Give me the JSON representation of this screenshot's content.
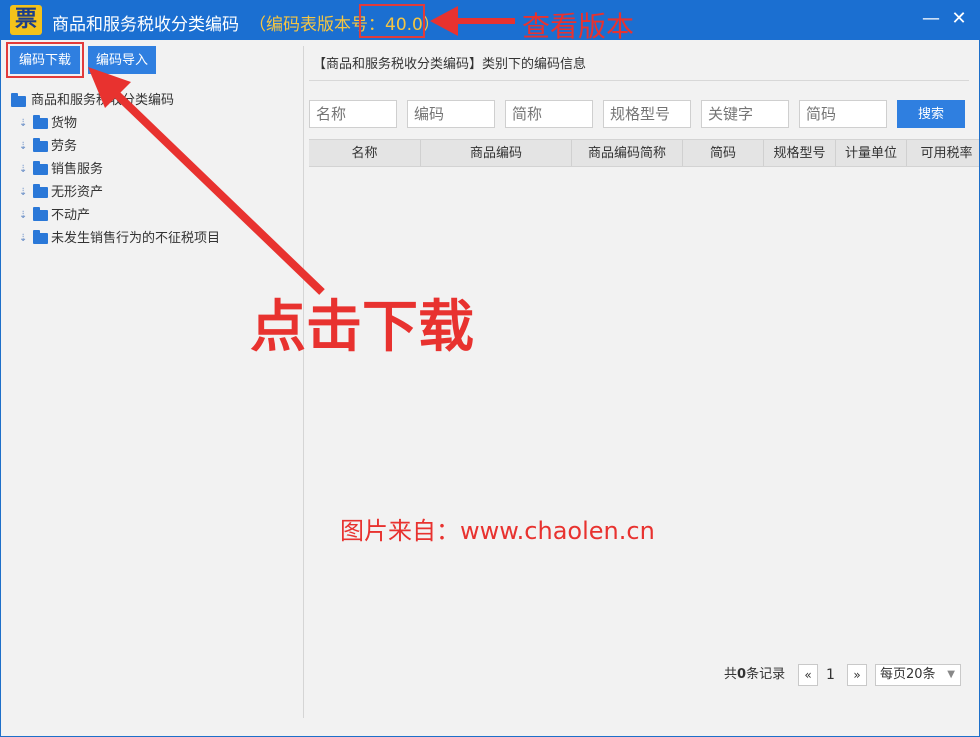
{
  "window": {
    "logo_char": "票",
    "title": "商品和服务税收分类编码",
    "version_text": "（编码表版本号：40.0）",
    "minimize_glyph": "—",
    "close_glyph": "✕"
  },
  "toolbar": {
    "download_label": "编码下载",
    "import_label": "编码导入"
  },
  "tree": {
    "root_label": "商品和服务税收分类编码",
    "items": [
      {
        "label": "货物"
      },
      {
        "label": "劳务"
      },
      {
        "label": "销售服务"
      },
      {
        "label": "无形资产"
      },
      {
        "label": "不动产"
      },
      {
        "label": "未发生销售行为的不征税项目"
      }
    ]
  },
  "panel": {
    "title": "【商品和服务税收分类编码】类别下的编码信息"
  },
  "filters": {
    "name_placeholder": "名称",
    "code_placeholder": "编码",
    "shortname_placeholder": "简称",
    "spec_placeholder": "规格型号",
    "keyword_placeholder": "关键字",
    "shortcode_placeholder": "简码",
    "search_label": "搜索"
  },
  "grid": {
    "columns": [
      "名称",
      "商品编码",
      "商品编码简称",
      "简码",
      "规格型号",
      "计量单位",
      "可用税率"
    ]
  },
  "pager": {
    "total_prefix": "共",
    "total_count": "0",
    "total_suffix": "条记录",
    "prev": "«",
    "page": "1",
    "next": "»",
    "page_size": "每页20条"
  },
  "annotations": {
    "version_note": "查看版本",
    "download_note": "点击下载",
    "source_note": "图片来自：www.chaolen.cn",
    "color": "#e8322f"
  },
  "colors": {
    "titlebar": "#1b6fd1",
    "button": "#2f7fe0",
    "version_text": "#f5c542"
  }
}
